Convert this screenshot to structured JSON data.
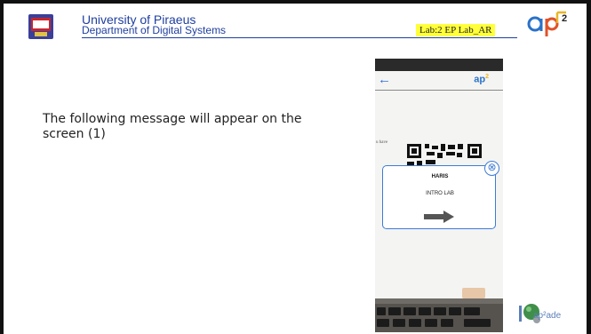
{
  "header": {
    "university": "University of Piraeus",
    "department": "Department of Digital Systems",
    "lab_tag": "Lab:2 EP Lab_AR",
    "ap2_logo_text": "ap",
    "ap2_superscript": "2"
  },
  "body": {
    "instruction": "The following message will appear on the screen (1)"
  },
  "phone": {
    "app_logo": "ap",
    "app_logo_sup": "2",
    "page_snippet": "u have",
    "popup": {
      "title": "HARIS",
      "subtitle": "INTRO LAB",
      "close_symbol": "⊗"
    }
  },
  "footer": {
    "logo_text": "ap²ade"
  },
  "colors": {
    "brand_blue": "#1f3fa0",
    "highlight_yellow": "#ffff3a",
    "popup_blue": "#3d7bd6"
  }
}
